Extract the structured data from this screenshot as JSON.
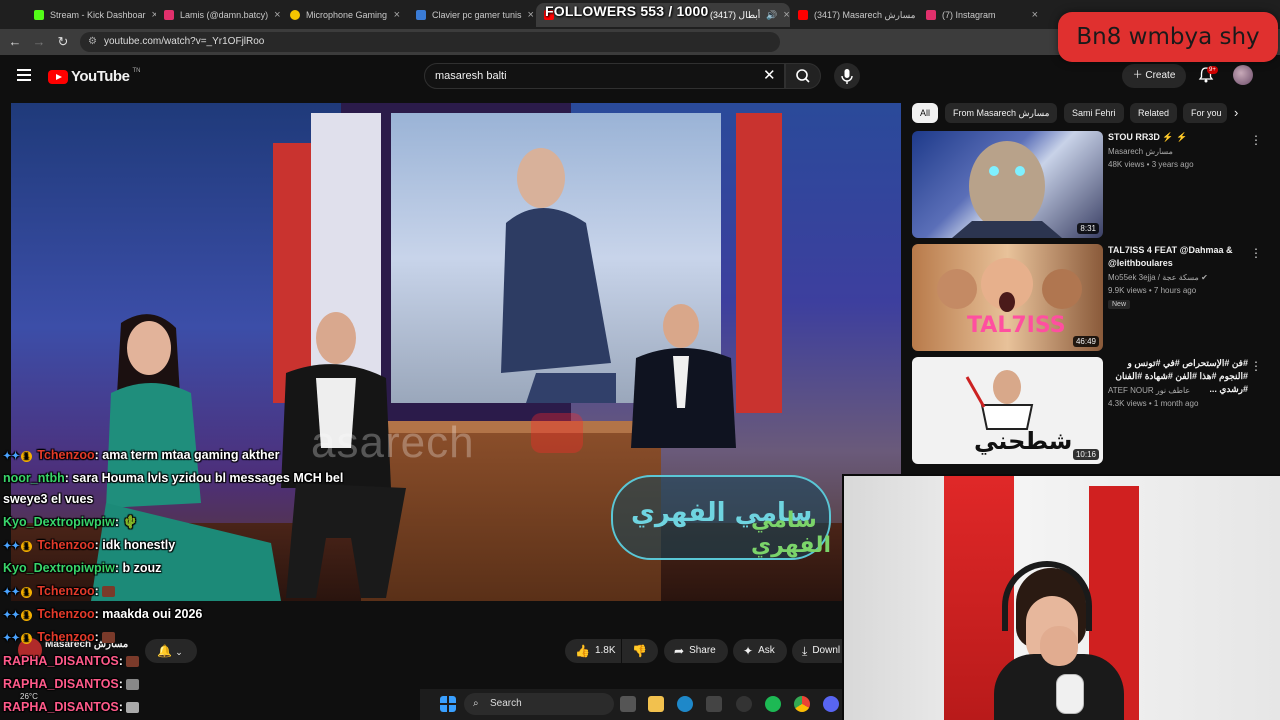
{
  "browser": {
    "tabs": [
      {
        "title": "Stream - Kick Dashboar",
        "color": "#53fc18"
      },
      {
        "title": "Lamis (@damn.batcy)",
        "color": "#e1306c"
      },
      {
        "title": "Microphone Gaming",
        "color": "#f5c400"
      },
      {
        "title": "Clavier pc gamer tunis",
        "color": "#3a7bd5"
      },
      {
        "title": "(3417) أبطال",
        "color": "#ff0000"
      },
      {
        "title": "(3417) Masarech مسارش",
        "color": "#ff0000"
      },
      {
        "title": "(7) Instagram",
        "color": "#e1306c"
      }
    ],
    "url": "youtube.com/watch?v=_Yr1OFjlRoo"
  },
  "overlay": {
    "followers": "FOLLOWERS 553 / 1000",
    "goal_tag": "Bn8 wmbya shy"
  },
  "youtube": {
    "logo": "YouTube",
    "logo_region": "TN",
    "search_query": "masaresh balti",
    "create_label": "Create",
    "notif_badge": "9+",
    "chips": [
      "All",
      "From Masarech مسارش",
      "Sami Fehri",
      "Related",
      "For you"
    ],
    "player": {
      "watermark": "asarech",
      "set_logo_1": "سامي الفهري",
      "set_logo_2": "سامي الفهري"
    },
    "below": {
      "channel": "Masarech مسارش",
      "likes": "1.8K",
      "share": "Share",
      "ask": "Ask",
      "download": "Downl"
    },
    "recommendations": [
      {
        "title": "STOU RR3D ⚡ ⚡",
        "channel": "Masarech مسارش",
        "meta": "48K views • 3 years ago",
        "duration": "8:31",
        "new": ""
      },
      {
        "title": "TAL7ISS 4 FEAT @Dahmaa & @leithboulares",
        "channel": "Mo55ek 3ejja / مسكة عجة ✔",
        "meta": "9.9K views • 7 hours ago",
        "duration": "46:49",
        "new": "New"
      },
      {
        "title": "#فن #الإستحراص #في #تونس و #النجوم #هذا #الفن #شهادة #الفنان #رشدي ...",
        "channel": "ATEF NOUR عاطف نور",
        "meta": "4.3K views • 1 month ago",
        "duration": "10:16",
        "new": ""
      }
    ]
  },
  "chat": [
    {
      "user": "Tchenzoo",
      "color": "#e33a2a",
      "badges": true,
      "text": ": ama term mtaa gaming akther"
    },
    {
      "user": "noor_ntbh",
      "color": "#39d56a",
      "badges": false,
      "text": ": sara Houma lvls yzidou bl messages MCH bel"
    },
    {
      "user": "",
      "color": "#ffffff",
      "badges": false,
      "text": "sweye3 el vues"
    },
    {
      "user": "Kyo_Dextropiwpiw",
      "color": "#39d56a",
      "badges": false,
      "text": ": 🌵"
    },
    {
      "user": "Tchenzoo",
      "color": "#e33a2a",
      "badges": true,
      "text": ": idk honestly"
    },
    {
      "user": "Kyo_Dextropiwpiw",
      "color": "#39d56a",
      "badges": false,
      "text": ": b zouz"
    },
    {
      "user": "Tchenzoo",
      "color": "#e33a2a",
      "badges": true,
      "text": ": "
    },
    {
      "user": "Tchenzoo",
      "color": "#e33a2a",
      "badges": true,
      "text": ": maakda oui 2026"
    },
    {
      "user": "Tchenzoo",
      "color": "#e33a2a",
      "badges": true,
      "text": ": "
    },
    {
      "user": "RAPHA_DISANTOS",
      "color": "#ff5a8a",
      "badges": false,
      "text": ": "
    },
    {
      "user": "RAPHA_DISANTOS",
      "color": "#ff5a8a",
      "badges": false,
      "text": ": "
    },
    {
      "user": "RAPHA_DISANTOS",
      "color": "#ff5a8a",
      "badges": false,
      "text": ": "
    }
  ],
  "taskbar": {
    "search": "Search",
    "weather": "26°C"
  }
}
